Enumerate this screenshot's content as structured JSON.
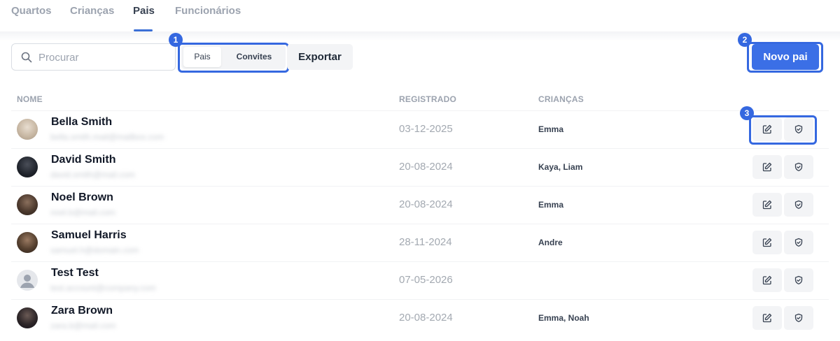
{
  "tabs": [
    {
      "label": "Quartos",
      "active": false
    },
    {
      "label": "Crianças",
      "active": false
    },
    {
      "label": "Pais",
      "active": true
    },
    {
      "label": "Funcionários",
      "active": false
    }
  ],
  "toolbar": {
    "search_placeholder": "Procurar",
    "segment": {
      "pais": "Pais",
      "convites": "Convites",
      "selected": "Pais"
    },
    "export_label": "Exportar",
    "new_label": "Novo pai"
  },
  "annotations": {
    "one": "1",
    "two": "2",
    "three": "3"
  },
  "accent_color": "#3568e0",
  "table": {
    "headers": {
      "name": "NOME",
      "registered": "REGISTRADO",
      "children": "CRIANÇAS"
    },
    "rows": [
      {
        "name": "Bella Smith",
        "email": "bella.smith.mail@mailbox.com",
        "registered": "03-12-2025",
        "children": "Emma",
        "avatar": "photo"
      },
      {
        "name": "David Smith",
        "email": "david.smith@mail.com",
        "registered": "20-08-2024",
        "children": "Kaya,  Liam",
        "avatar": "photo"
      },
      {
        "name": "Noel Brown",
        "email": "noel.b@mail.com",
        "registered": "20-08-2024",
        "children": "Emma",
        "avatar": "photo"
      },
      {
        "name": "Samuel Harris",
        "email": "samuel.h@domain.com",
        "registered": "28-11-2024",
        "children": "Andre",
        "avatar": "photo"
      },
      {
        "name": "Test Test",
        "email": "test.account@company.com",
        "registered": "07-05-2026",
        "children": "",
        "avatar": "placeholder"
      },
      {
        "name": "Zara Brown",
        "email": "zara.b@mail.com",
        "registered": "20-08-2024",
        "children": "Emma,  Noah",
        "avatar": "photo"
      }
    ]
  },
  "icons": {
    "search": "search-icon",
    "edit": "edit-icon",
    "shield": "shield-icon",
    "user": "user-placeholder-icon"
  }
}
